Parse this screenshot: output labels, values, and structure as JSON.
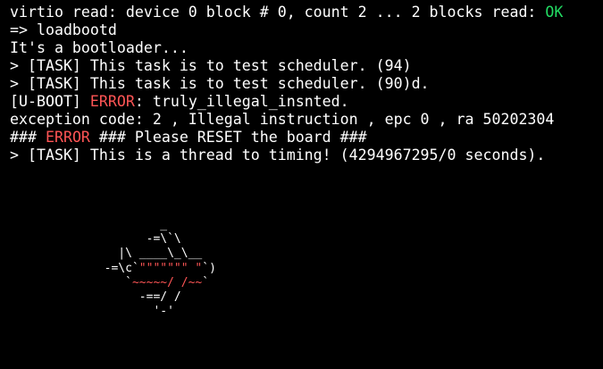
{
  "colors": {
    "background": "#000000",
    "text": "#ffffff",
    "ok": "#22dc63",
    "error": "#ff5555"
  },
  "terminal": {
    "lines": [
      {
        "pre": "virtio read: device 0 block # 0, count 2 ... 2 blocks read: ",
        "hl": "OK",
        "hl_type": "ok",
        "post": ""
      },
      {
        "pre": "=> loadbootd",
        "hl": "",
        "hl_type": "",
        "post": ""
      },
      {
        "pre": "It's a bootloader...",
        "hl": "",
        "hl_type": "",
        "post": ""
      },
      {
        "pre": "> [TASK] This task is to test scheduler. (94)",
        "hl": "",
        "hl_type": "",
        "post": ""
      },
      {
        "pre": "> [TASK] This task is to test scheduler. (90)d.",
        "hl": "",
        "hl_type": "",
        "post": ""
      },
      {
        "pre": "[U-BOOT] ",
        "hl": "ERROR",
        "hl_type": "err",
        "post": ": truly_illegal_insnted."
      },
      {
        "pre": "exception code: 2 , Illegal instruction , epc 0 , ra 50202304",
        "hl": "",
        "hl_type": "",
        "post": ""
      },
      {
        "pre": "### ",
        "hl": "ERROR",
        "hl_type": "err",
        "post": " ### Please RESET the board ###"
      },
      {
        "pre": "> [TASK] This is a thread to timing! (4294967295/0 seconds).",
        "hl": "",
        "hl_type": "",
        "post": ""
      }
    ],
    "ascii_art": [
      {
        "pre": "          _",
        "hl": "",
        "hl_type": "",
        "post": ""
      },
      {
        "pre": "        -=\\`\\",
        "hl": "",
        "hl_type": "",
        "post": ""
      },
      {
        "pre": "    |\\ ____\\_\\__",
        "hl": "",
        "hl_type": "",
        "post": ""
      },
      {
        "pre": "  -=\\c`",
        "hl": "\"\"\"\"\"\"\" \"",
        "hl_type": "err",
        "post": "`)"
      },
      {
        "pre": "     `",
        "hl": "~~~~~/ /~~",
        "hl_type": "err",
        "post": "`"
      },
      {
        "pre": "       -==/ /",
        "hl": "",
        "hl_type": "",
        "post": ""
      },
      {
        "pre": "         '-'",
        "hl": "",
        "hl_type": "",
        "post": ""
      }
    ]
  }
}
